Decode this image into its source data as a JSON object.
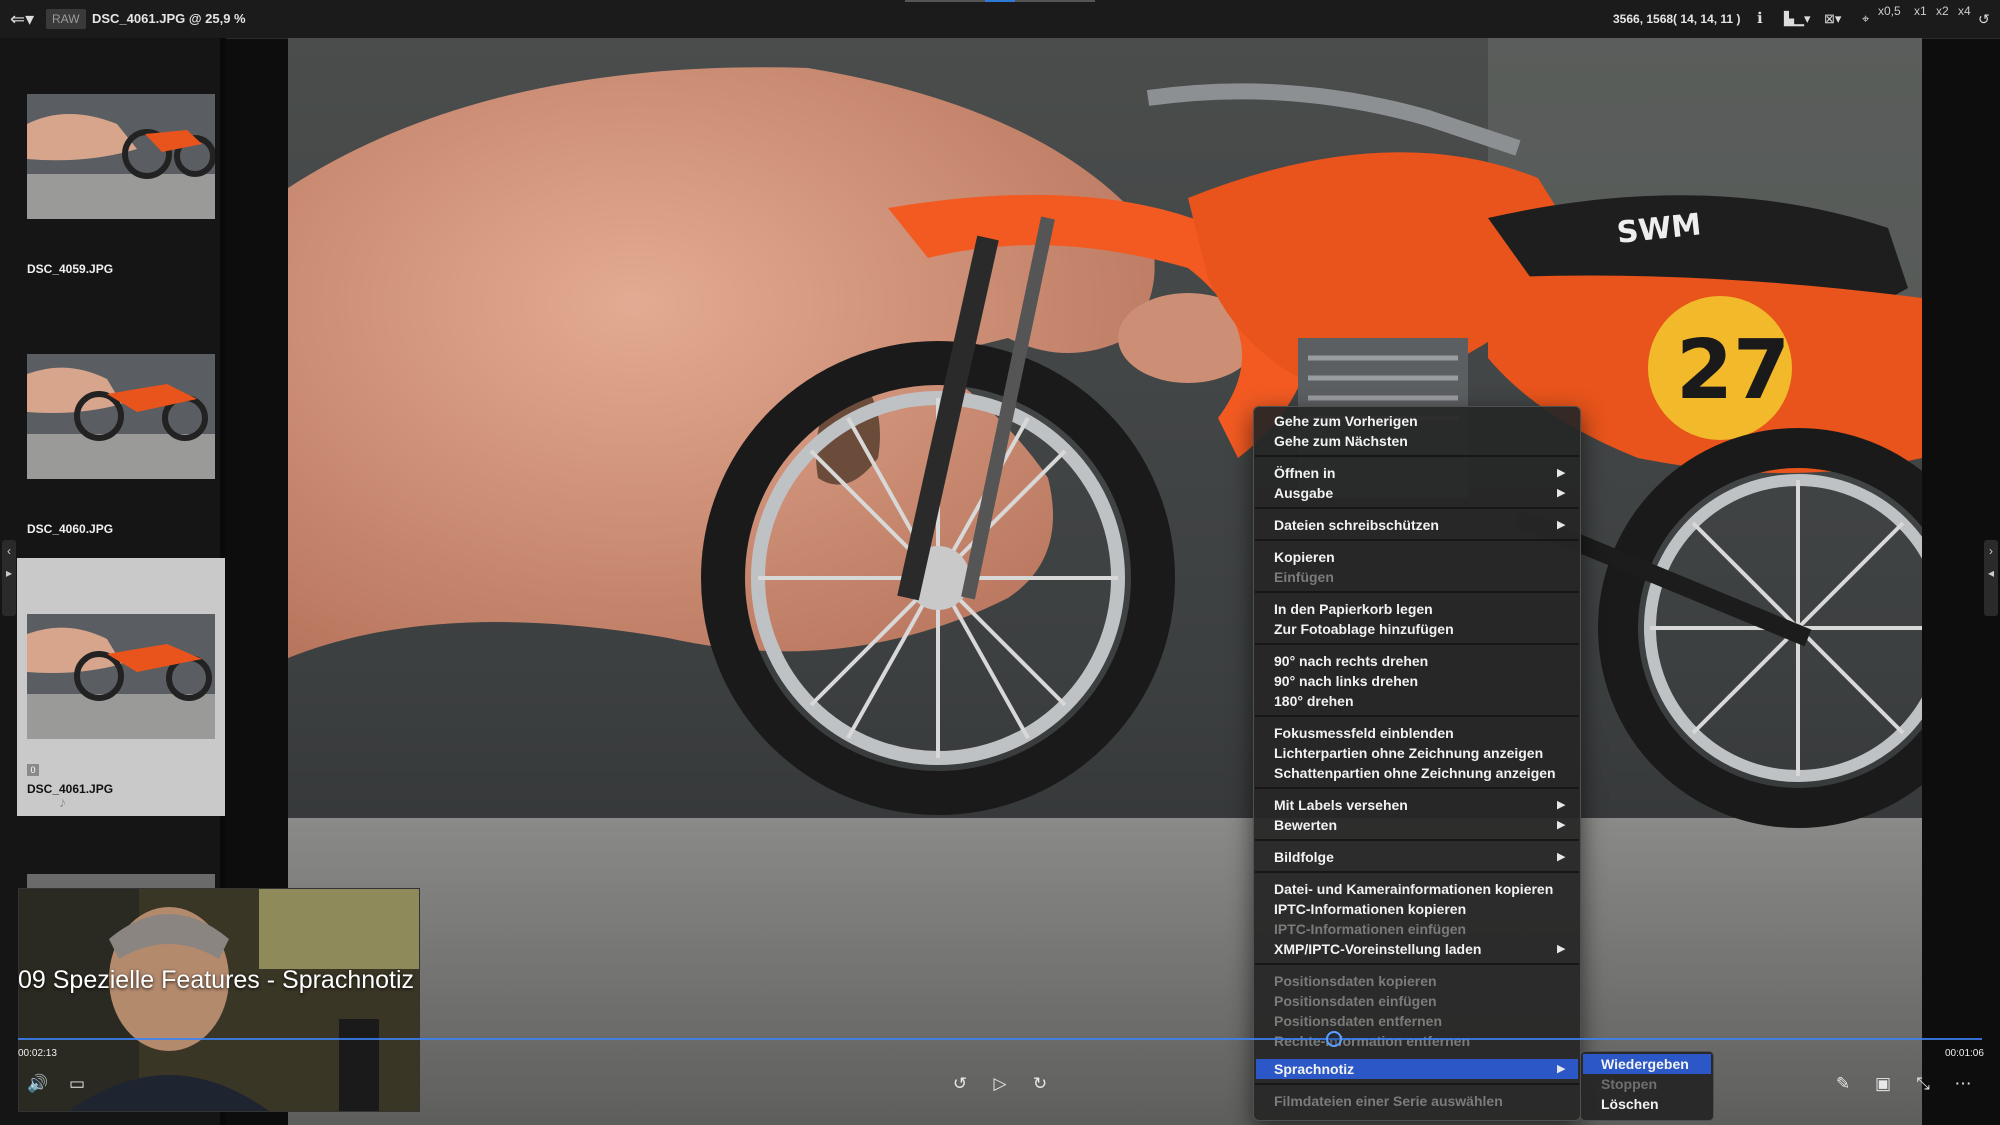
{
  "topbar": {
    "raw_badge": "RAW",
    "title": "DSC_4061.JPG @ 25,9 %",
    "coords": "3566, 1568( 14, 14, 11 )",
    "zoom_levels": [
      "x0,5",
      "x1",
      "x2",
      "x4"
    ]
  },
  "sidebar": {
    "thumbs": [
      {
        "name": "DSC_4059.JPG"
      },
      {
        "name": "DSC_4060.JPG"
      },
      {
        "name": "DSC_4061.JPG",
        "tag": "0"
      }
    ]
  },
  "photo": {
    "number_plate": "27",
    "seat_brand": "SWM"
  },
  "context_menu": {
    "go_prev": "Gehe zum Vorherigen",
    "go_next": "Gehe zum Nächsten",
    "open_in": "Öffnen in",
    "output": "Ausgabe",
    "protect": "Dateien schreibschützen",
    "copy": "Kopieren",
    "paste": "Einfügen",
    "trash": "In den Papierkorb legen",
    "photo_tray": "Zur Fotoablage hinzufügen",
    "rot_right": "90° nach rechts drehen",
    "rot_left": "90° nach links drehen",
    "rot_180": "180° drehen",
    "focus": "Fokusmessfeld einblenden",
    "highlights": "Lichterpartien ohne Zeichnung anzeigen",
    "shadows": "Schattenpartien ohne Zeichnung anzeigen",
    "labels": "Mit Labels versehen",
    "rate": "Bewerten",
    "slideshow": "Bildfolge",
    "copy_file_cam": "Datei- und Kamerainformationen kopieren",
    "copy_iptc": "IPTC-Informationen kopieren",
    "paste_iptc": "IPTC-Informationen einfügen",
    "load_xmp": "XMP/IPTC-Voreinstellung laden",
    "copy_pos": "Positionsdaten kopieren",
    "paste_pos": "Positionsdaten einfügen",
    "remove_pos": "Positionsdaten entfernen",
    "remove_rights": "Rechte-Information entfernen",
    "voice_memo": "Sprachnotiz",
    "select_series": "Filmdateien einer Serie auswählen"
  },
  "submenu": {
    "play": "Wiedergeben",
    "stop": "Stoppen",
    "delete": "Löschen"
  },
  "video": {
    "title": "09 Spezielle Features - Sprachnotiz",
    "current_time": "00:02:13",
    "end_time": "00:01:06",
    "progress_fraction": 0.67
  },
  "colors": {
    "menu_highlight": "#2b58c6",
    "seek_bar": "#3b82f6",
    "bike_orange": "#e8541b"
  }
}
